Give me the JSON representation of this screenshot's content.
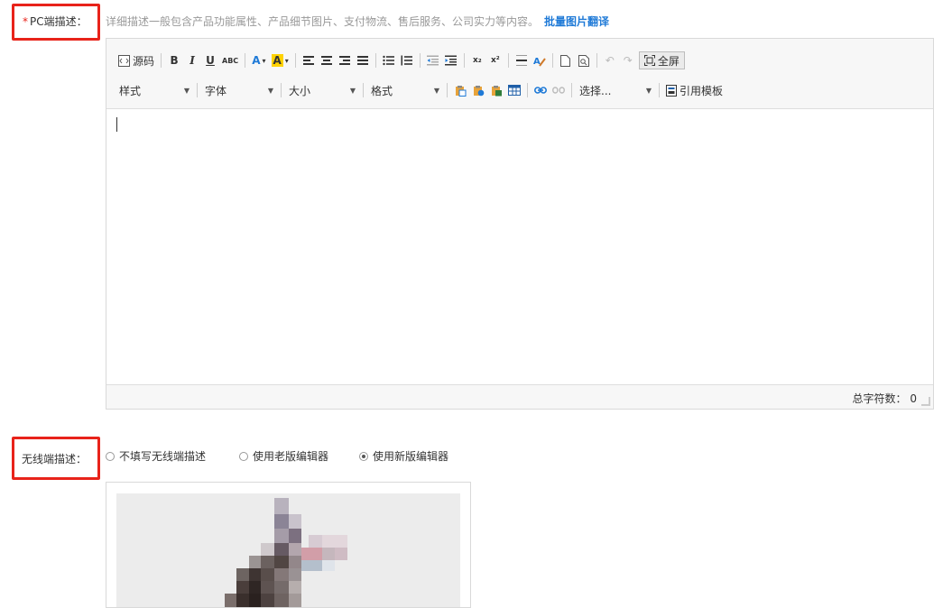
{
  "pc_desc": {
    "required_mark": "*",
    "label": "PC端描述：",
    "hint": "详细描述一般包含产品功能属性、产品细节图片、支付物流、售后服务、公司实力等内容。",
    "link": "批量图片翻译"
  },
  "toolbar": {
    "source_label": "源码",
    "bold": "B",
    "italic": "I",
    "underline": "U",
    "strike": "ABC",
    "font_color": "A",
    "bg_color": "A",
    "subscript": "x₂",
    "superscript": "x²",
    "fullscreen_label": "全屏",
    "style_dd": "样式",
    "font_dd": "字体",
    "size_dd": "大小",
    "format_dd": "格式",
    "select_dd": "选择...",
    "template_label": "引用模板"
  },
  "editor": {
    "char_count_label": "总字符数：",
    "char_count": "0"
  },
  "mobile_desc": {
    "label": "无线端描述：",
    "options": [
      {
        "label": "不填写无线端描述",
        "selected": false
      },
      {
        "label": "使用老版编辑器",
        "selected": false
      },
      {
        "label": "使用新版编辑器",
        "selected": true
      }
    ]
  },
  "colors": {
    "highlight_red": "#e8231a",
    "link_blue": "#1f7ad7",
    "hint_gray": "#999999"
  }
}
